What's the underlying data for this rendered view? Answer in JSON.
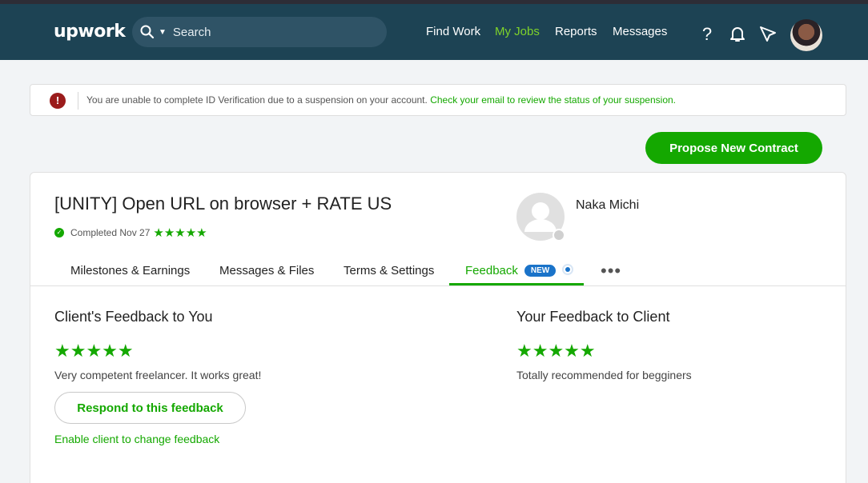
{
  "header": {
    "logo": "upwork",
    "search_placeholder": "Search",
    "nav": [
      {
        "label": "Find Work",
        "active": false
      },
      {
        "label": "My Jobs",
        "active": true
      },
      {
        "label": "Reports",
        "active": false
      },
      {
        "label": "Messages",
        "active": false
      }
    ],
    "icons": [
      "help-icon",
      "bell-icon",
      "send-icon",
      "avatar"
    ]
  },
  "alert": {
    "message": "You are unable to complete ID Verification due to a suspension on your account.",
    "link": "Check your email to review the status of your suspension.",
    "icon": "!"
  },
  "actions": {
    "propose_label": "Propose New Contract"
  },
  "contract": {
    "title": "[UNITY] Open URL on browser + RATE US",
    "status": "Completed Nov 27",
    "rating_stars": "★★★★★",
    "client_name": "Naka Michi"
  },
  "tabs": [
    {
      "label": "Milestones & Earnings"
    },
    {
      "label": "Messages & Files"
    },
    {
      "label": "Terms & Settings"
    },
    {
      "label": "Feedback",
      "badge": "NEW",
      "active": true
    }
  ],
  "more_label": "•••",
  "feedback": {
    "client_heading": "Client's Feedback to You",
    "client_stars": "★★★★★",
    "client_text": "Very competent freelancer. It works great!",
    "respond_label": "Respond to this feedback",
    "enable_label": "Enable client to change feedback",
    "your_heading": "Your Feedback to Client",
    "your_stars": "★★★★★",
    "your_text": "Totally recommended for begginers"
  },
  "colors": {
    "brand_green": "#14a800",
    "header_bg": "#1d4354",
    "badge_blue": "#1a73c9"
  }
}
